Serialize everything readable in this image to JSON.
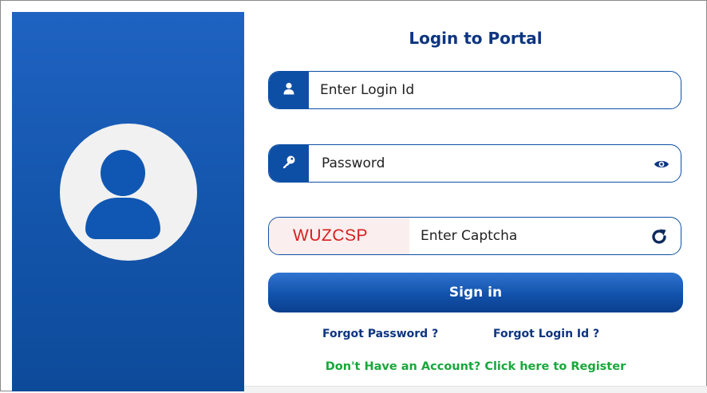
{
  "login": {
    "title": "Login to Portal",
    "login_id_placeholder": "Enter Login Id",
    "password_placeholder": "Password",
    "captcha_code": "WUZCSP",
    "captcha_placeholder": "Enter Captcha",
    "signin_label": "Sign in",
    "forgot_password_label": "Forgot Password ?",
    "forgot_login_id_label": "Forgot Login Id ?",
    "register_label": "Don't Have an Account? Click here to Register"
  },
  "icons": {
    "login_id": "user-icon",
    "password": "key-icon",
    "show_password": "eye-icon",
    "refresh_captcha": "refresh-icon",
    "avatar": "user-avatar-icon"
  },
  "colors": {
    "panel_blue": "#1456ad",
    "primary": "#0e4fa6",
    "title": "#0d3580",
    "captcha_text": "#d71f1f",
    "captcha_bg": "#fbeeee",
    "register_green": "#17a83a"
  }
}
